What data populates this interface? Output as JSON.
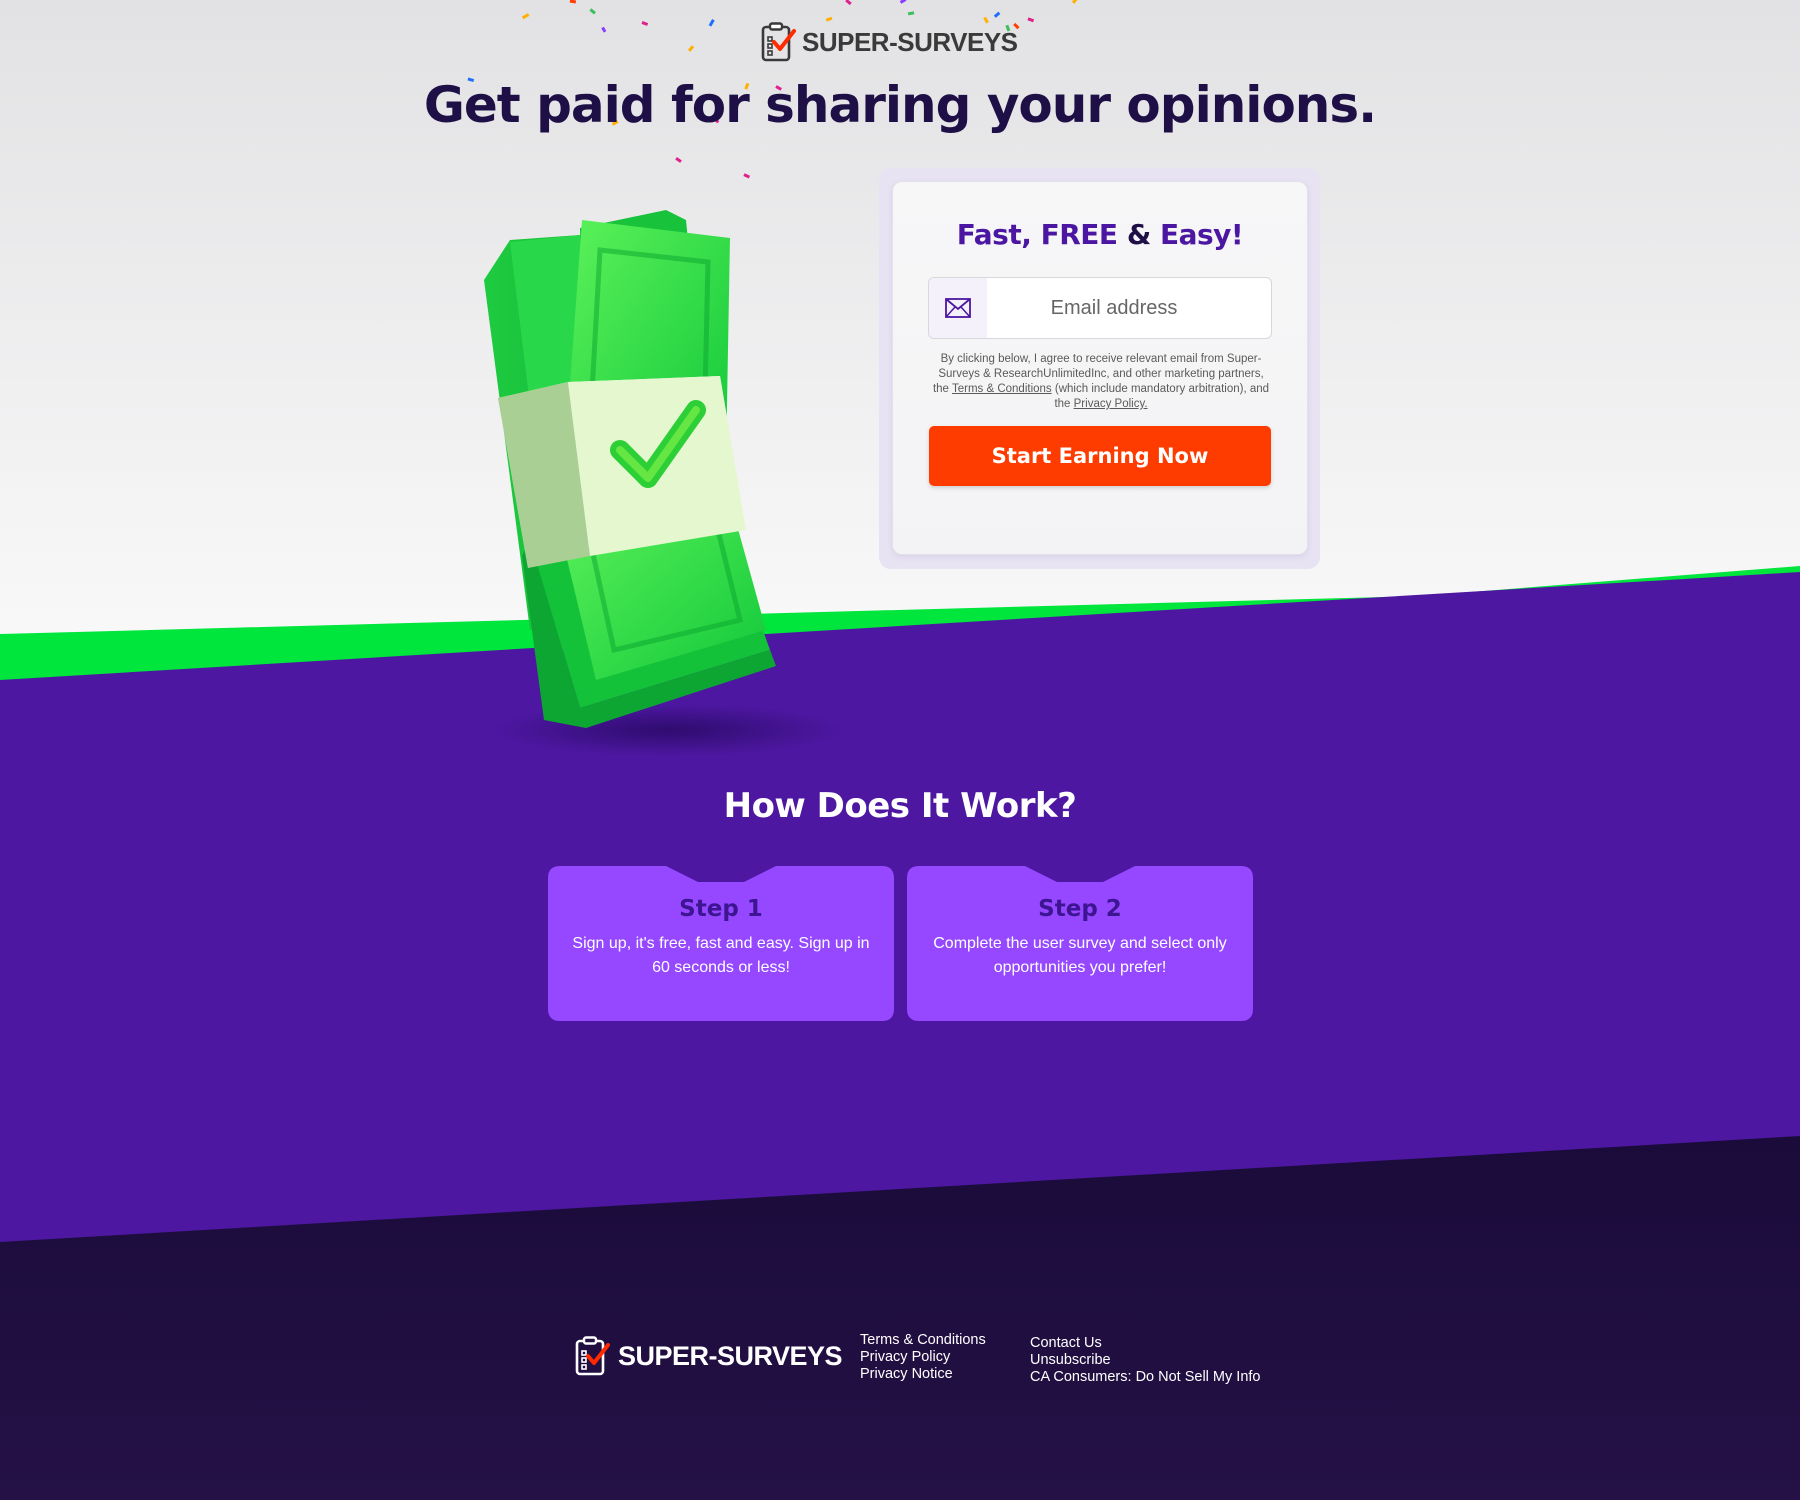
{
  "header": {
    "logo_text": "SUPER-SURVEYS",
    "headline": "Get paid for sharing your opinions."
  },
  "form": {
    "title_part1": "Fast, FREE",
    "title_amp": "&",
    "title_part2": "Easy!",
    "email_placeholder": "Email address",
    "disclaimer_pre": "By clicking below, I agree to receive relevant email from Super-Surveys & ResearchUnlimitedInc, and other marketing partners, the",
    "terms_link": "Terms & Conditions",
    "disclaimer_mid": "(which include mandatory arbitration), and the",
    "privacy_link": "Privacy Policy.",
    "cta_label": "Start Earning Now"
  },
  "how": {
    "title": "How Does It Work?",
    "steps": [
      {
        "title": "Step 1",
        "text": "Sign up, it's free, fast and easy. Sign up in 60 seconds or less!"
      },
      {
        "title": "Step 2",
        "text": "Complete the user survey and select only opportunities you prefer!"
      }
    ]
  },
  "footer": {
    "logo_text": "SUPER-SURVEYS",
    "col1": [
      "Terms & Conditions",
      "Privacy Policy",
      "Privacy Notice"
    ],
    "col2": [
      "Contact Us",
      "Unsubscribe",
      "CA Consumers: Do Not Sell My Info"
    ]
  },
  "colors": {
    "purple": "#4d17a1",
    "dark_purple": "#241043",
    "green": "#00e63c",
    "cta": "#ff3c00",
    "step_card": "#9548ff"
  }
}
